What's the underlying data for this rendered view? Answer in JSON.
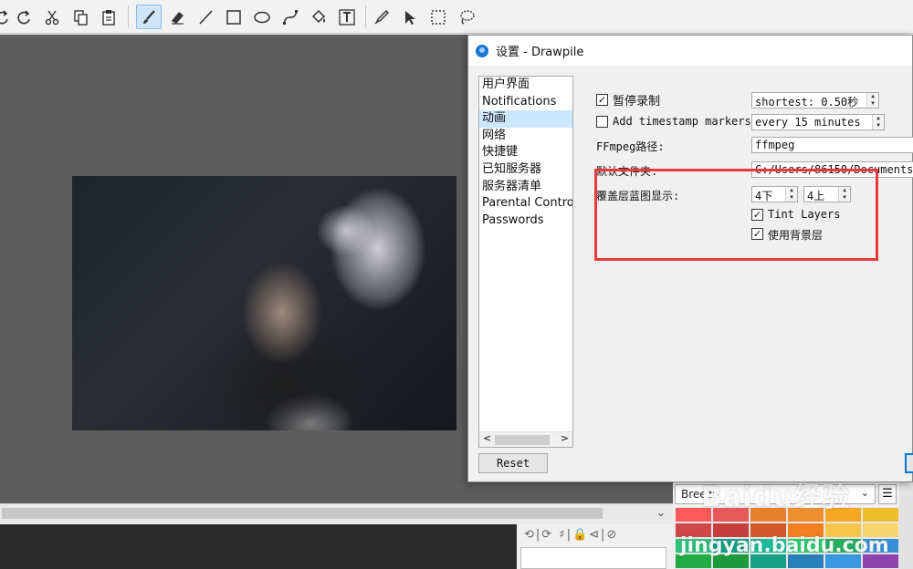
{
  "toolbar": {
    "tools": [
      {
        "name": "redo-partial-icon",
        "glyph": "↻"
      },
      {
        "name": "redo-icon",
        "glyph": "↷"
      },
      {
        "name": "cut-icon",
        "glyph": "✂"
      },
      {
        "name": "copy-icon",
        "glyph": "⎘"
      },
      {
        "name": "paste-icon",
        "glyph": "📋"
      },
      {
        "name": "brush-icon",
        "glyph": "🖌"
      },
      {
        "name": "eraser-icon",
        "glyph": "⌫"
      },
      {
        "name": "line-icon",
        "glyph": "/"
      },
      {
        "name": "rectangle-icon",
        "glyph": "▭"
      },
      {
        "name": "ellipse-icon",
        "glyph": "◯"
      },
      {
        "name": "bezier-icon",
        "glyph": "∫"
      },
      {
        "name": "fill-icon",
        "glyph": "🪣"
      },
      {
        "name": "text-icon",
        "glyph": "T"
      },
      {
        "name": "color-picker-icon",
        "glyph": "✎"
      },
      {
        "name": "pointer-icon",
        "glyph": "➤"
      },
      {
        "name": "selection-rect-icon",
        "glyph": "⬚"
      },
      {
        "name": "lasso-icon",
        "glyph": "◌"
      }
    ]
  },
  "dialog": {
    "title": "设置 - Drawpile",
    "nav_items": [
      "用户界面",
      "Notifications",
      "动画",
      "网络",
      "快捷键",
      "已知服务器",
      "服务器清单",
      "Parental Controls",
      "Passwords"
    ],
    "selected_nav": "动画",
    "reset_label": "Reset",
    "pause_recording": {
      "label": "暂停录制",
      "checked": true,
      "value": "shortest: 0.50秒"
    },
    "timestamp_markers": {
      "label": "Add timestamp markers",
      "checked": false,
      "value": "every 15 minutes"
    },
    "ffmpeg": {
      "label": "FFmpeg路径:",
      "value": "ffmpeg"
    },
    "snapshot_folder": {
      "label": "默认文件夹:",
      "value": "C:/Users/86150/Documents"
    },
    "onion_skin": {
      "label": "覆盖层蓝图显示:",
      "below": "4下",
      "above": "4上"
    },
    "tint_layers": {
      "label": "Tint Layers",
      "checked": true
    },
    "use_background": {
      "label": "使用背景层",
      "checked": true
    }
  },
  "palette": {
    "selected": "Breeze",
    "menu_icon": "hamburger-icon",
    "colors": [
      "#ff5858",
      "#e85858",
      "#e87f2a",
      "#ef8e2e",
      "#f5a623",
      "#eebe2a",
      "#d04747",
      "#c63d3d",
      "#d4572a",
      "#f08020",
      "#f5c64a",
      "#f7d36a",
      "#2ec27e",
      "#16a085",
      "#1abc9c",
      "#2ecc71",
      "#27ae60",
      "#3a8fd8",
      "#22aa44",
      "#1e9a3c",
      "#16a085",
      "#2980b9",
      "#3a98e0",
      "#8e44ad"
    ]
  },
  "layers": {
    "toolbar_glyphs": "⟲|⟳ ♯|🔒⊲|⊘"
  },
  "watermark": {
    "line1": "Baidu经验",
    "line2": "jingyan.baidu.com"
  },
  "colors": {
    "accent": "#0078d7",
    "highlight": "#e83a3a",
    "selection": "#cce8ff"
  }
}
